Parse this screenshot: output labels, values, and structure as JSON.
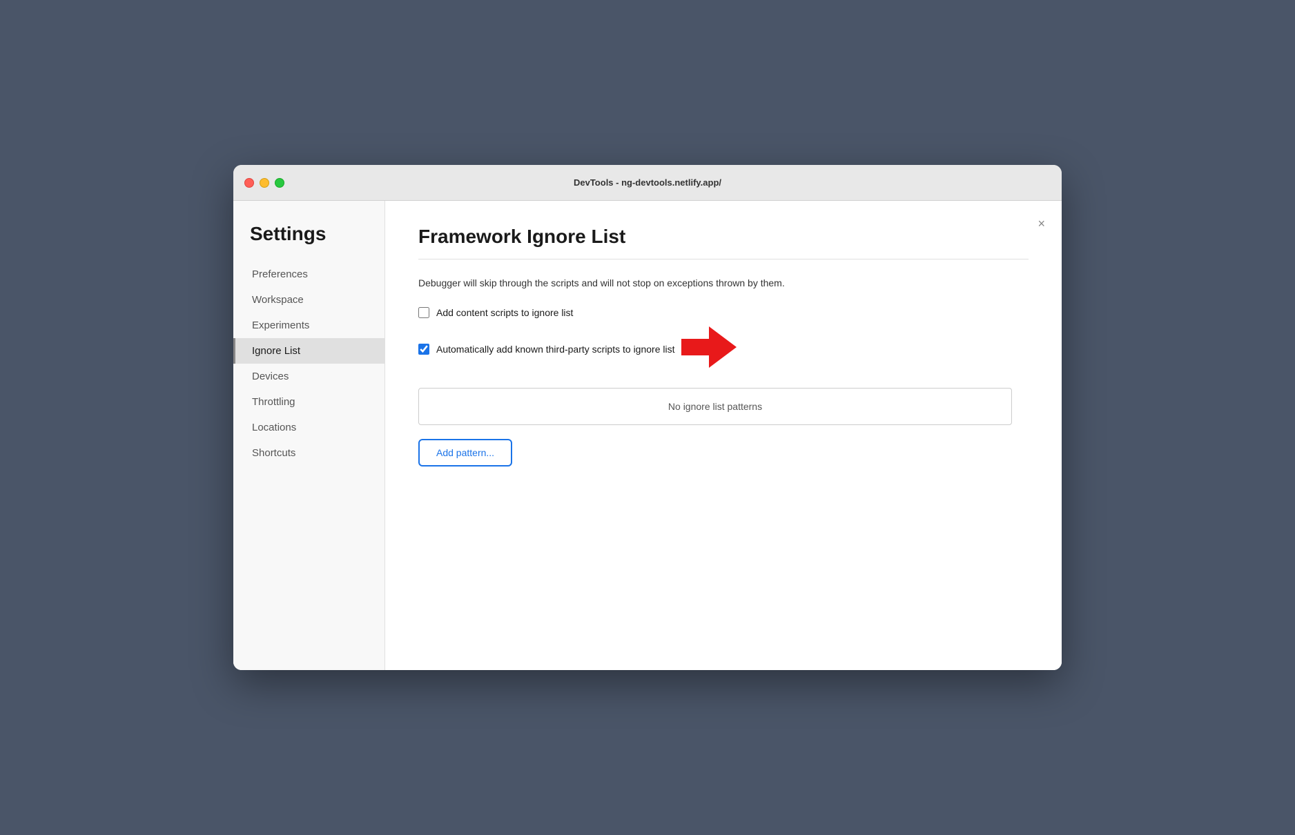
{
  "window": {
    "title": "DevTools - ng-devtools.netlify.app/"
  },
  "sidebar": {
    "heading": "Settings",
    "items": [
      {
        "id": "preferences",
        "label": "Preferences",
        "active": false
      },
      {
        "id": "workspace",
        "label": "Workspace",
        "active": false
      },
      {
        "id": "experiments",
        "label": "Experiments",
        "active": false
      },
      {
        "id": "ignore-list",
        "label": "Ignore List",
        "active": true
      },
      {
        "id": "devices",
        "label": "Devices",
        "active": false
      },
      {
        "id": "throttling",
        "label": "Throttling",
        "active": false
      },
      {
        "id": "locations",
        "label": "Locations",
        "active": false
      },
      {
        "id": "shortcuts",
        "label": "Shortcuts",
        "active": false
      }
    ]
  },
  "main": {
    "title": "Framework Ignore List",
    "description": "Debugger will skip through the scripts and will not stop on exceptions thrown by them.",
    "close_label": "×",
    "checkboxes": [
      {
        "id": "add-content-scripts",
        "label": "Add content scripts to ignore list",
        "checked": false
      },
      {
        "id": "auto-add-third-party",
        "label": "Automatically add known third-party scripts to ignore list",
        "checked": true
      }
    ],
    "no_patterns_text": "No ignore list patterns",
    "add_pattern_label": "Add pattern..."
  }
}
